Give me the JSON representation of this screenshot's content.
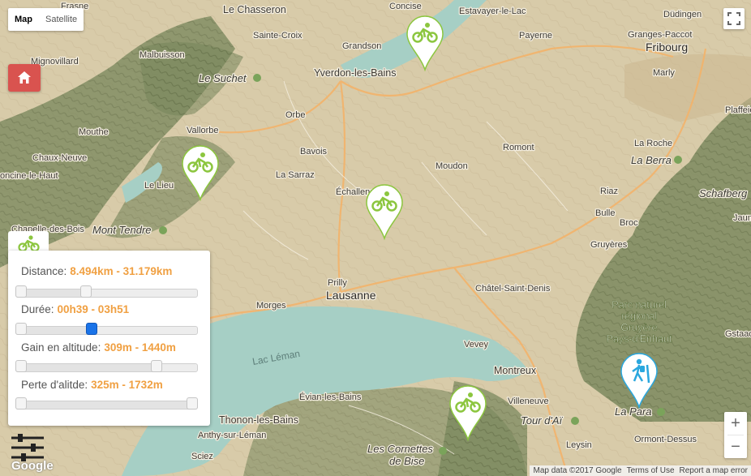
{
  "map_type": {
    "options": [
      "Map",
      "Satellite"
    ],
    "selected": "Map"
  },
  "labels": {
    "le_chasseron": "Le Chasseron",
    "concise": "Concise",
    "estavayer": "Estavayer-le-Lac",
    "dudingen": "Düdingen",
    "frasne": "Frasne",
    "sainte_croix": "Sainte-Croix",
    "grandson": "Grandson",
    "payerne": "Payerne",
    "granges_paccot": "Granges-Paccot",
    "mignovillard": "Mignovillard",
    "malbuisson": "Malbuisson",
    "fribourg": "Fribourg",
    "marly": "Marly",
    "le_suchet": "Le Suchet",
    "yverdon": "Yverdon-les-Bains",
    "plaffeien": "Plaffeie",
    "mouthe": "Mouthe",
    "vallorbe": "Vallorbe",
    "orbe": "Orbe",
    "chaux_neuve": "Chaux-Neuve",
    "romont": "Romont",
    "la_roche": "La Roche",
    "foncine": "oncine-le-Haut",
    "bavois": "Bavois",
    "la_berra": "La Berra",
    "la_sarraz": "La Sarraz",
    "moudon": "Moudon",
    "le_lieu": "Le Lieu",
    "echallens": "Échallens",
    "riaz": "Riaz",
    "schafberg": "Schafberg",
    "bulle": "Bulle",
    "broc": "Broc",
    "jaun": "Jaun",
    "chapelle": "Chapelle-des-Bois",
    "mont_tendre": "Mont Tendre",
    "gruyeres": "Gruyères",
    "prilly": "Prilly",
    "chatel": "Châtel-Saint-Denis",
    "lausanne": "Lausanne",
    "parc_1": "Parc naturel",
    "parc_2": "régional",
    "parc_3": "Gruyère",
    "parc_4": "Pays-d'Enhaut",
    "morges": "Morges",
    "gstaad": "Gstaad",
    "lac_leman": "Lac Léman",
    "vevey": "Vevey",
    "montreux": "Montreux",
    "evian": "Évian-les-Bains",
    "villeneuve": "Villeneuve",
    "tour_dai": "Tour d'Aï",
    "la_para": "La Para",
    "thonon": "Thonon-les-Bains",
    "ormont": "Ormont-Dessus",
    "anthy": "Anthy-sur-Léman",
    "les_cornettes_1": "Les Cornettes",
    "les_cornettes_2": "de Bise",
    "leysin": "Leysin",
    "sciez": "Sciez",
    "google": "Google"
  },
  "filters": {
    "distance": {
      "label": "Distance:",
      "value": "8.494km - 31.179km",
      "min_frac": 0.0,
      "max_frac": 0.38
    },
    "duree": {
      "label": "Durée:",
      "value": "00h39 - 03h51",
      "min_frac": 0.0,
      "max_frac": 0.41
    },
    "gain": {
      "label": "Gain en altitude:",
      "value": "309m - 1440m",
      "min_frac": 0.0,
      "max_frac": 0.79
    },
    "perte": {
      "label": "Perte d'alitde:",
      "value": "325m - 1732m",
      "min_frac": 0.0,
      "max_frac": 1.0
    }
  },
  "markers": [
    {
      "type": "bike-icon",
      "color": "#8cc63f"
    },
    {
      "type": "bike-icon",
      "color": "#8cc63f"
    },
    {
      "type": "bike-icon",
      "color": "#8cc63f"
    },
    {
      "type": "bike-icon",
      "color": "#8cc63f"
    },
    {
      "type": "hiker-icon",
      "color": "#2aa7de"
    }
  ],
  "footer": {
    "map_data": "Map data ©2017 Google",
    "terms": "Terms of Use",
    "report": "Report a map error"
  },
  "colors": {
    "home_button": "#d9534f",
    "filter_value": "#f0a042",
    "bike_marker": "#8cc63f",
    "hike_marker": "#2aa7de"
  }
}
